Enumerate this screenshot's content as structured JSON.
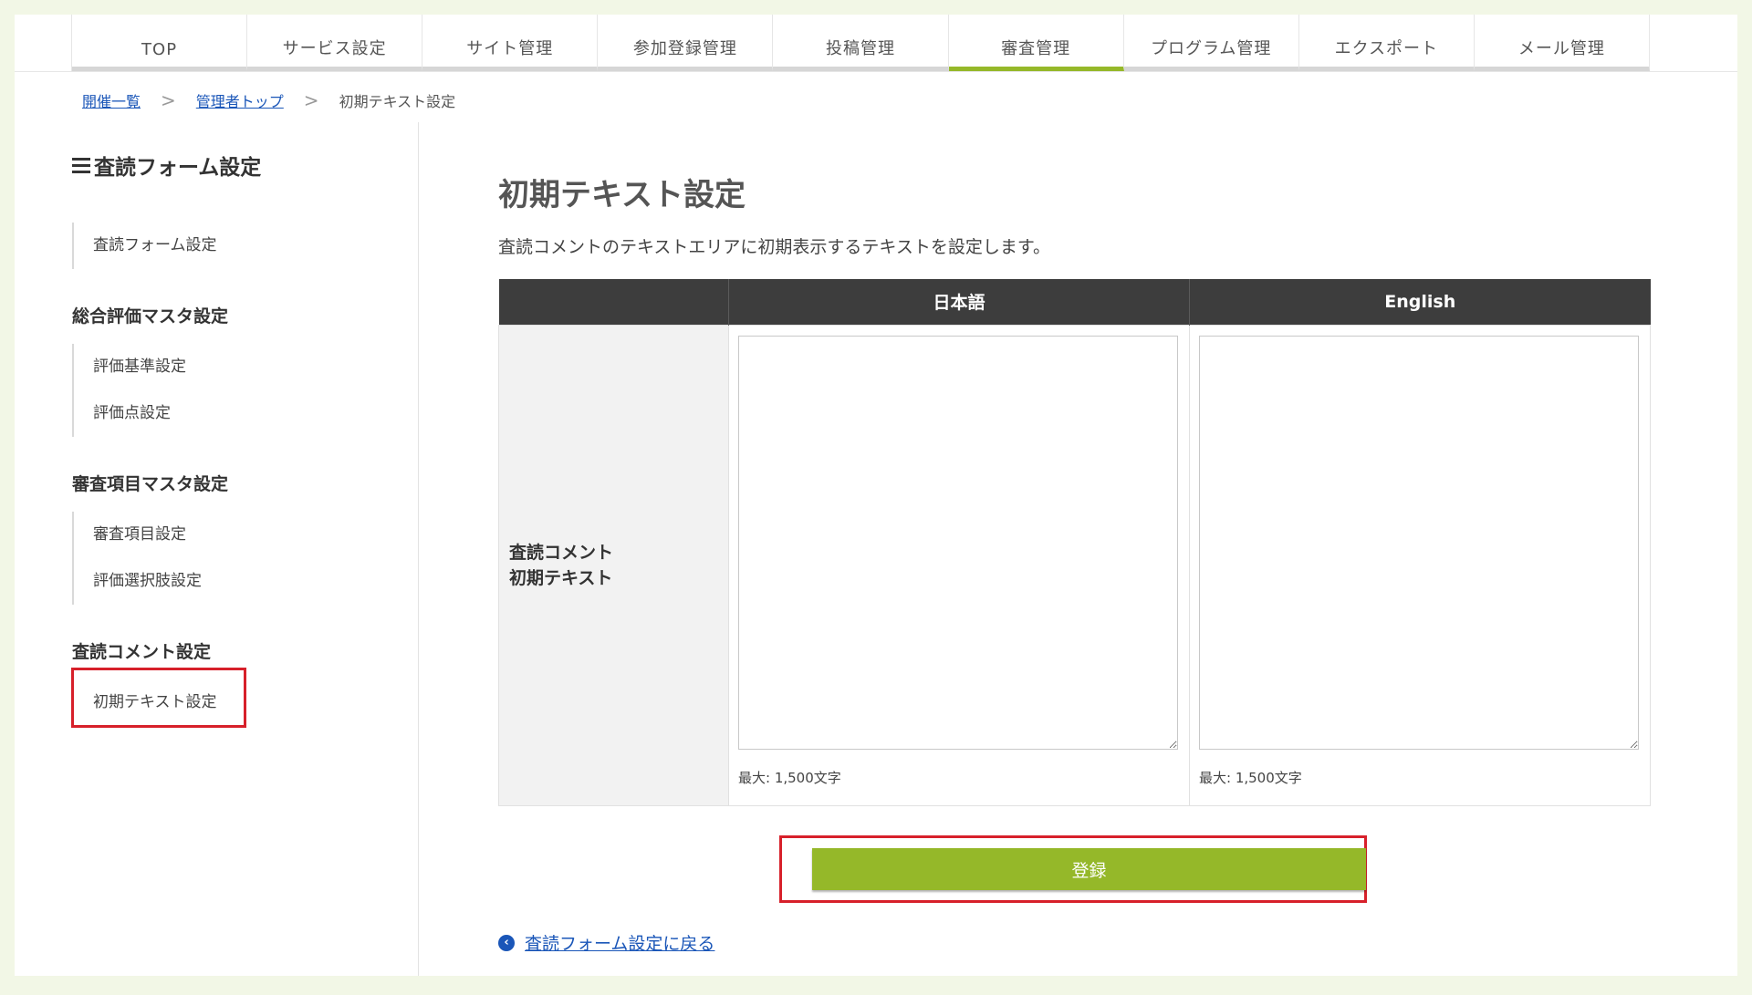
{
  "nav": {
    "items": [
      {
        "label": "TOP"
      },
      {
        "label": "サービス設定"
      },
      {
        "label": "サイト管理"
      },
      {
        "label": "参加登録管理"
      },
      {
        "label": "投稿管理"
      },
      {
        "label": "審査管理"
      },
      {
        "label": "プログラム管理"
      },
      {
        "label": "エクスポート"
      },
      {
        "label": "メール管理"
      }
    ],
    "active_index": 5,
    "accent_color": "#95b829"
  },
  "breadcrumb": {
    "items": [
      "開催一覧",
      "管理者トップ"
    ],
    "separator": ">",
    "current": "初期テキスト設定"
  },
  "sidebar": {
    "title": "査読フォーム設定",
    "groups": [
      {
        "heading": "",
        "items": [
          "査読フォーム設定"
        ]
      },
      {
        "heading": "総合評価マスタ設定",
        "items": [
          "評価基準設定",
          "評価点設定"
        ]
      },
      {
        "heading": "審査項目マスタ設定",
        "items": [
          "審査項目設定",
          "評価選択肢設定"
        ]
      },
      {
        "heading": "査読コメント設定",
        "items": [
          "初期テキスト設定"
        ]
      }
    ]
  },
  "main": {
    "title": "初期テキスト設定",
    "description": "査読コメントのテキストエリアに初期表示するテキストを設定します。",
    "table": {
      "columns": [
        "",
        "日本語",
        "English"
      ],
      "row_label_line1": "査読コメント",
      "row_label_line2": "初期テキスト",
      "ja_value": "",
      "en_value": "",
      "ja_max": "最大: 1,500文字",
      "en_max": "最大: 1,500文字"
    },
    "submit_label": "登録",
    "back_link": "査読フォーム設定に戻る"
  },
  "colors": {
    "highlight": "#d7202a",
    "link": "#1a56b8",
    "header_bg": "#3d3d3d",
    "page_bg": "#f2f7e6"
  }
}
